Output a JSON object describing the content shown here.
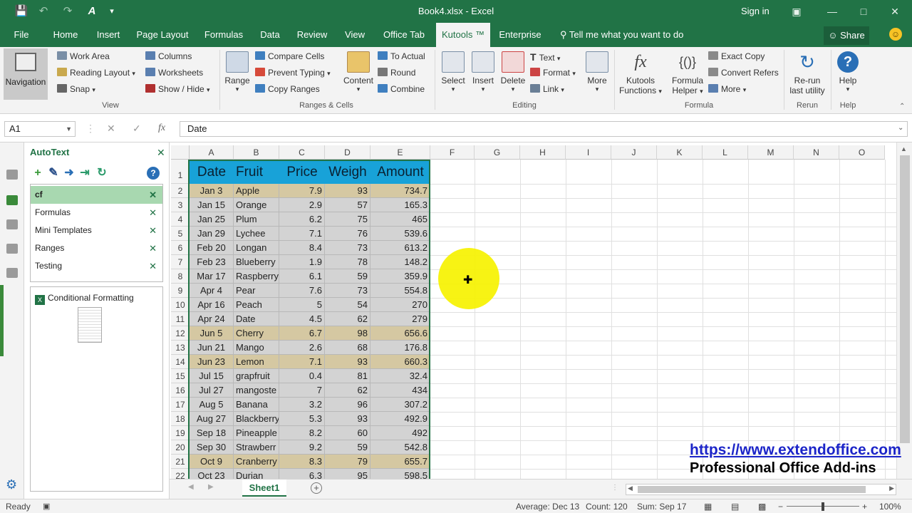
{
  "window": {
    "title": "Book4.xlsx  -  Excel",
    "sign_in": "Sign in"
  },
  "tabs": [
    "File",
    "Home",
    "Insert",
    "Page Layout",
    "Formulas",
    "Data",
    "Review",
    "View",
    "Office Tab",
    "Kutools ™",
    "Enterprise"
  ],
  "tell_me": "Tell me what you want to do",
  "share": "Share",
  "ribbon": {
    "view_group": {
      "navigation": "Navigation",
      "work_area": "Work Area",
      "reading_layout": "Reading Layout",
      "snap": "Snap",
      "columns": "Columns",
      "worksheets": "Worksheets",
      "show_hide": "Show / Hide",
      "label": "View"
    },
    "ranges_group": {
      "range": "Range",
      "compare_cells": "Compare Cells",
      "prevent_typing": "Prevent Typing",
      "copy_ranges": "Copy Ranges",
      "content": "Content",
      "to_actual": "To Actual",
      "round": "Round",
      "combine": "Combine",
      "label": "Ranges & Cells"
    },
    "editing_group": {
      "select": "Select",
      "insert": "Insert",
      "delete": "Delete",
      "text": "Text",
      "format": "Format",
      "link": "Link",
      "more": "More",
      "label": "Editing"
    },
    "formula_group": {
      "kutools_functions_1": "Kutools",
      "kutools_functions_2": "Functions",
      "formula_helper_1": "Formula",
      "formula_helper_2": "Helper",
      "exact_copy": "Exact Copy",
      "convert_refers": "Convert Refers",
      "more": "More",
      "label": "Formula"
    },
    "rerun_group": {
      "rerun_1": "Re-run",
      "rerun_2": "last utility",
      "label": "Rerun"
    },
    "help_group": {
      "help": "Help",
      "label": "Help"
    }
  },
  "formula_bar": {
    "name_box": "A1",
    "content": "Date"
  },
  "pane": {
    "title": "AutoText",
    "items": [
      "cf",
      "Formulas",
      "Mini Templates",
      "Ranges",
      "Testing"
    ],
    "entry": "Conditional Formatting"
  },
  "columns": [
    "A",
    "B",
    "C",
    "D",
    "E",
    "F",
    "G",
    "H",
    "I",
    "J",
    "K",
    "L",
    "M",
    "N",
    "O"
  ],
  "table": {
    "headers": [
      "Date",
      "Fruit",
      "Price",
      "Weigh",
      "Amount"
    ],
    "rows": [
      [
        "Jan 3",
        "Apple",
        "7.9",
        "93",
        "734.7"
      ],
      [
        "Jan 15",
        "Orange",
        "2.9",
        "57",
        "165.3"
      ],
      [
        "Jan 25",
        "Plum",
        "6.2",
        "75",
        "465"
      ],
      [
        "Jan 29",
        "Lychee",
        "7.1",
        "76",
        "539.6"
      ],
      [
        "Feb 20",
        "Longan",
        "8.4",
        "73",
        "613.2"
      ],
      [
        "Feb 23",
        "Blueberry",
        "1.9",
        "78",
        "148.2"
      ],
      [
        "Mar 17",
        "Raspberry",
        "6.1",
        "59",
        "359.9"
      ],
      [
        "Apr 4",
        "Pear",
        "7.6",
        "73",
        "554.8"
      ],
      [
        "Apr 16",
        "Peach",
        "5",
        "54",
        "270"
      ],
      [
        "Apr 24",
        "Date",
        "4.5",
        "62",
        "279"
      ],
      [
        "Jun 5",
        "Cherry",
        "6.7",
        "98",
        "656.6"
      ],
      [
        "Jun 21",
        "Mango",
        "2.6",
        "68",
        "176.8"
      ],
      [
        "Jun 23",
        "Lemon",
        "7.1",
        "93",
        "660.3"
      ],
      [
        "Jul 15",
        "grapfruit",
        "0.4",
        "81",
        "32.4"
      ],
      [
        "Jul 27",
        "mangoste",
        "7",
        "62",
        "434"
      ],
      [
        "Aug 5",
        "Banana",
        "3.2",
        "96",
        "307.2"
      ],
      [
        "Aug 27",
        "Blackberry",
        "5.3",
        "93",
        "492.9"
      ],
      [
        "Sep 18",
        "Pineapple",
        "8.2",
        "60",
        "492"
      ],
      [
        "Sep 30",
        "Strawberr",
        "9.2",
        "59",
        "542.8"
      ],
      [
        "Oct 9",
        "Cranberry",
        "8.3",
        "79",
        "655.7"
      ],
      [
        "Oct 23",
        "Durian",
        "6.3",
        "95",
        "598.5"
      ]
    ],
    "highlighted_rows": [
      0,
      10,
      12,
      19
    ],
    "colors": {
      "header": "#18a2d8",
      "highlight": "#d5c8a2",
      "normal": "#d3d3d3"
    }
  },
  "sheet": {
    "tab": "Sheet1"
  },
  "status": {
    "ready": "Ready",
    "average": "Average: Dec 13",
    "count": "Count: 120",
    "sum": "Sum: Sep 17",
    "zoom": "100%"
  },
  "watermark": {
    "url": "https://www.extendoffice.com",
    "tagline": "Professional Office Add-ins"
  }
}
